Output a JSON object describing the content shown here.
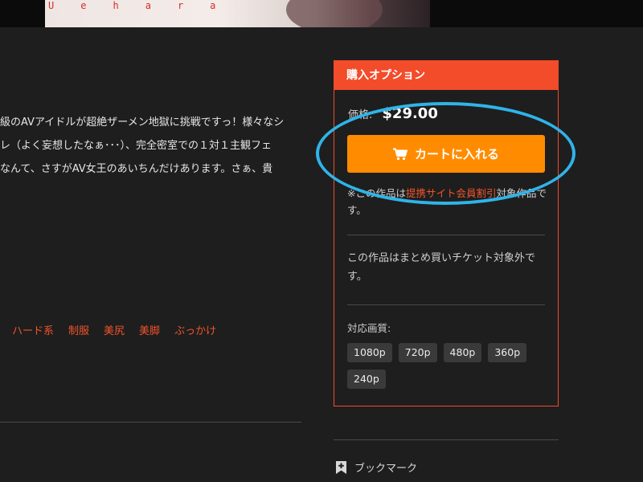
{
  "banner": {
    "letters": [
      "U",
      "e",
      "h",
      "a",
      "r",
      "a"
    ]
  },
  "description": {
    "lines": [
      "級のAVアイドルが超絶ザーメン地獄に挑戦ですっ！様々なシ",
      "レ（よく妄想したなぁ･･･）、完全密室での１対１主観フェ",
      "なんて、さすがAV女王のあいちんだけあります。さぁ、貴"
    ]
  },
  "tags": [
    "ハード系",
    "制服",
    "美尻",
    "美脚",
    "ぶっかけ"
  ],
  "purchase": {
    "title": "購入オプション",
    "price_label": "価格:",
    "price_value": "$29.00",
    "cart_button": "カートに入れる",
    "note_prefix": "※この作品は",
    "note_link": "提携サイト会員割引",
    "note_suffix": "対象作品です。",
    "ticket_note": "この作品はまとめ買いチケット対象外です。",
    "quality_label": "対応画質:",
    "resolutions": [
      "1080p",
      "720p",
      "480p",
      "360p",
      "240p"
    ]
  },
  "bookmark_label": "ブックマーク",
  "colors": {
    "accent": "#f24c2a",
    "cart": "#ff8c00",
    "highlight_ring": "#2fb4e9",
    "background": "#1e1e1e"
  }
}
